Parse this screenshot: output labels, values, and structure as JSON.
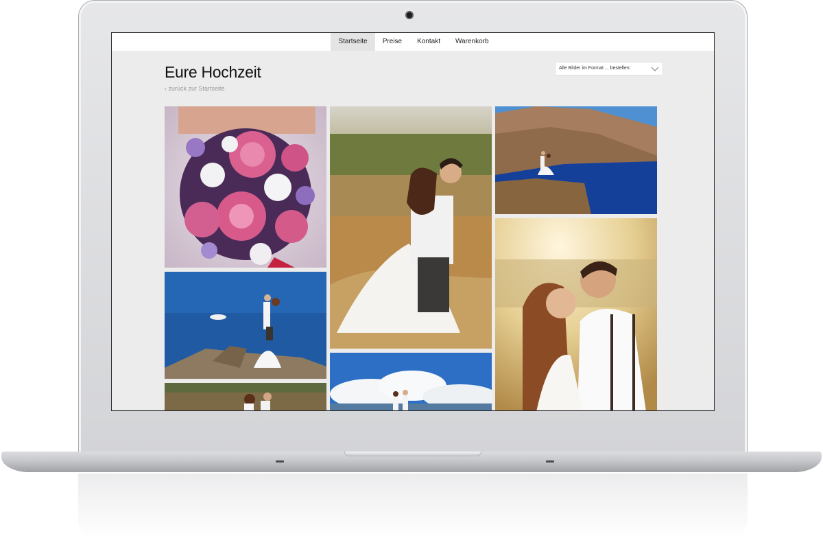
{
  "nav": {
    "items": [
      {
        "label": "Startseite",
        "active": true
      },
      {
        "label": "Preise",
        "active": false
      },
      {
        "label": "Kontakt",
        "active": false
      },
      {
        "label": "Warenkorb",
        "active": false
      }
    ]
  },
  "page": {
    "title": "Eure Hochzeit",
    "back_link": "‹ zurück zur Startseite"
  },
  "format_select": {
    "label": "Alle Bilder im Format ... bestellen:",
    "icon": "chevron-down-icon"
  },
  "gallery": {
    "photos": [
      {
        "name": "photo-bouquet",
        "subject": "wedding bouquet"
      },
      {
        "name": "photo-couple-field",
        "subject": "couple in wheat field"
      },
      {
        "name": "photo-couple-cliff",
        "subject": "couple on cliff by sea"
      },
      {
        "name": "photo-couple-rock-sea",
        "subject": "couple on rock by sea"
      },
      {
        "name": "photo-couple-kiss-sunset",
        "subject": "couple kissing at sunset"
      },
      {
        "name": "photo-couple-clouds",
        "subject": "couple under clouds"
      },
      {
        "name": "photo-couple-meadow",
        "subject": "couple in meadow"
      }
    ]
  }
}
